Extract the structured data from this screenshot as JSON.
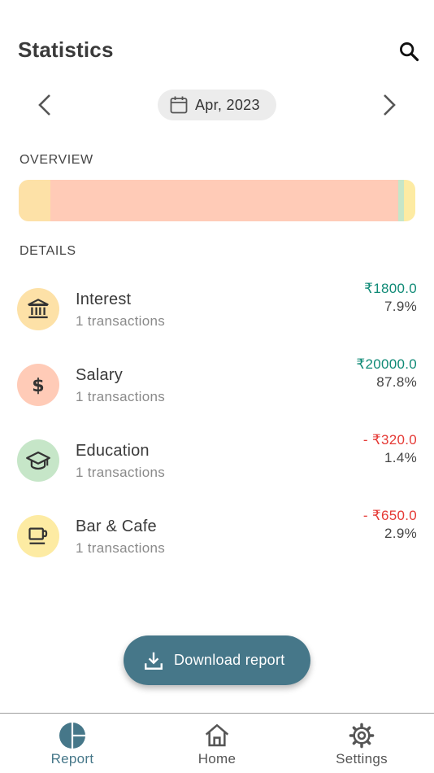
{
  "header": {
    "title": "Statistics",
    "search_icon": "search-icon"
  },
  "month_nav": {
    "label": "Apr, 2023",
    "prev_icon": "chevron-left-icon",
    "next_icon": "chevron-right-icon",
    "calendar_icon": "calendar-icon"
  },
  "overview": {
    "label": "OVERVIEW",
    "segments": [
      {
        "name": "Interest",
        "percent": 7.9,
        "color": "#FDE1A7"
      },
      {
        "name": "Salary",
        "percent": 87.8,
        "color": "#FFCBB7"
      },
      {
        "name": "Education",
        "percent": 1.4,
        "color": "#C6E6C8"
      },
      {
        "name": "Bar & Cafe",
        "percent": 2.9,
        "color": "#FDEBA3"
      }
    ]
  },
  "details": {
    "label": "DETAILS",
    "items": [
      {
        "name": "Interest",
        "count": "1 transactions",
        "amount": "₹1800.0",
        "percent": "7.9%",
        "type": "income",
        "icon": "bank-icon",
        "bg": "#FDE1A7"
      },
      {
        "name": "Salary",
        "count": "1 transactions",
        "amount": "₹20000.0",
        "percent": "87.8%",
        "type": "income",
        "icon": "dollar-icon",
        "bg": "#FFCBB7"
      },
      {
        "name": "Education",
        "count": "1 transactions",
        "amount": "- ₹320.0",
        "percent": "1.4%",
        "type": "expense",
        "icon": "graduation-cap-icon",
        "bg": "#C6E6C8"
      },
      {
        "name": "Bar & Cafe",
        "count": "1 transactions",
        "amount": "- ₹650.0",
        "percent": "2.9%",
        "type": "expense",
        "icon": "coffee-cup-icon",
        "bg": "#FDEBA3"
      }
    ]
  },
  "download": {
    "label": "Download report",
    "icon": "download-icon"
  },
  "bottom_nav": {
    "report": {
      "label": "Report",
      "icon": "pie-chart-icon",
      "active": true
    },
    "home": {
      "label": "Home",
      "icon": "home-icon",
      "active": false
    },
    "settings": {
      "label": "Settings",
      "icon": "gear-icon",
      "active": false
    }
  },
  "colors": {
    "income": "#0F8A76",
    "expense": "#E53935",
    "accent": "#467789",
    "nav_inactive": "#555555"
  }
}
